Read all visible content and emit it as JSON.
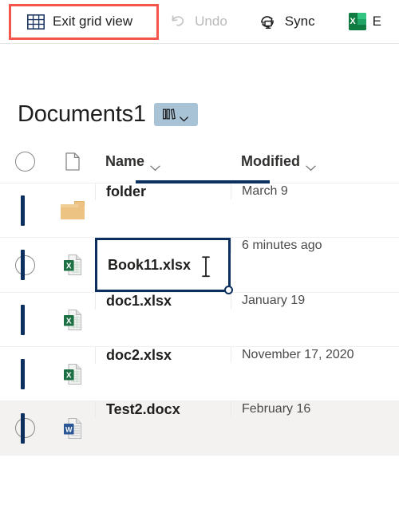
{
  "toolbar": {
    "items": [
      {
        "label": "Exit grid view",
        "icon": "grid-icon",
        "state": "highlighted"
      },
      {
        "label": "Undo",
        "icon": "undo-icon",
        "state": "disabled"
      },
      {
        "label": "Sync",
        "icon": "sync-icon",
        "state": "enabled"
      },
      {
        "label": "E",
        "icon": "excel-logo-icon",
        "state": "enabled"
      }
    ],
    "exit_grid_view_label": "Exit grid view",
    "undo_label": "Undo",
    "sync_label": "Sync",
    "excel_label": "E",
    "highlight_color": "#f4554a"
  },
  "header": {
    "title": "Documents1",
    "library_badge": {
      "icon": "books-icon",
      "chevron": "chevron-down-icon"
    }
  },
  "table": {
    "columns": [
      {
        "key": "select",
        "label": "",
        "icon": "select-all-circle-icon"
      },
      {
        "key": "type",
        "label": "",
        "icon": "file-type-icon"
      },
      {
        "key": "name",
        "label": "Name",
        "sorted": true,
        "chevron": "chevron-down-icon"
      },
      {
        "key": "modified",
        "label": "Modified",
        "sorted": false,
        "chevron": "chevron-down-icon"
      }
    ],
    "name_label": "Name",
    "modified_label": "Modified",
    "accent_color": "#0b2f5e",
    "rows": [
      {
        "name": "folder",
        "modified": "March 9",
        "icon": "folder-icon",
        "checkbox_visible": false,
        "hovered": false,
        "selected": false
      },
      {
        "name": "Book11.xlsx",
        "modified": "6 minutes ago",
        "icon": "excel-file-icon",
        "checkbox_visible": true,
        "hovered": false,
        "selected": true
      },
      {
        "name": "doc1.xlsx",
        "modified": "January 19",
        "icon": "excel-file-icon",
        "checkbox_visible": false,
        "hovered": false,
        "selected": false
      },
      {
        "name": "doc2.xlsx",
        "modified": "November 17, 2020",
        "icon": "excel-file-icon",
        "checkbox_visible": false,
        "hovered": false,
        "selected": false
      },
      {
        "name": "Test2.docx",
        "modified": "February 16",
        "icon": "word-file-icon",
        "checkbox_visible": true,
        "hovered": true,
        "selected": false
      }
    ]
  }
}
